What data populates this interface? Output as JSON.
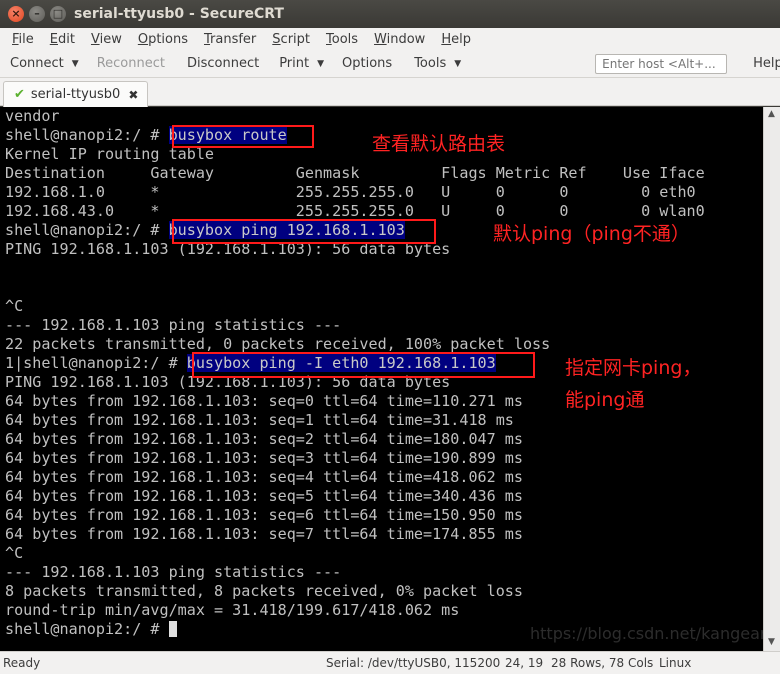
{
  "window": {
    "title": "serial-ttyusb0 - SecureCRT"
  },
  "menu": {
    "items": [
      {
        "mnemonic": "F",
        "rest": "ile"
      },
      {
        "mnemonic": "E",
        "rest": "dit"
      },
      {
        "mnemonic": "V",
        "rest": "iew"
      },
      {
        "mnemonic": "O",
        "rest": "ptions"
      },
      {
        "mnemonic": "T",
        "rest": "ransfer"
      },
      {
        "mnemonic": "S",
        "rest": "cript"
      },
      {
        "mnemonic": "T",
        "rest": "ools"
      },
      {
        "mnemonic": "W",
        "rest": "indow"
      },
      {
        "mnemonic": "H",
        "rest": "elp"
      }
    ]
  },
  "toolbar": {
    "connect": "Connect",
    "reconnect": "Reconnect",
    "disconnect": "Disconnect",
    "print": "Print",
    "options": "Options",
    "tools": "Tools",
    "host_placeholder": "Enter host <Alt+...",
    "help": "Help"
  },
  "tab": {
    "label": "serial-ttyusb0"
  },
  "terminal": {
    "lines": [
      "vendor",
      "shell@nanopi2:/ # busybox route",
      "Kernel IP routing table",
      "Destination     Gateway         Genmask         Flags Metric Ref    Use Iface",
      "192.168.1.0     *               255.255.255.0   U     0      0        0 eth0",
      "192.168.43.0    *               255.255.255.0   U     0      0        0 wlan0",
      "shell@nanopi2:/ # busybox ping 192.168.1.103",
      "PING 192.168.1.103 (192.168.1.103): 56 data bytes",
      "",
      "",
      "^C",
      "--- 192.168.1.103 ping statistics ---",
      "22 packets transmitted, 0 packets received, 100% packet loss",
      "1|shell@nanopi2:/ # busybox ping -I eth0 192.168.1.103",
      "PING 192.168.1.103 (192.168.1.103): 56 data bytes",
      "64 bytes from 192.168.1.103: seq=0 ttl=64 time=110.271 ms",
      "64 bytes from 192.168.1.103: seq=1 ttl=64 time=31.418 ms",
      "64 bytes from 192.168.1.103: seq=2 ttl=64 time=180.047 ms",
      "64 bytes from 192.168.1.103: seq=3 ttl=64 time=190.899 ms",
      "64 bytes from 192.168.1.103: seq=4 ttl=64 time=418.062 ms",
      "64 bytes from 192.168.1.103: seq=5 ttl=64 time=340.436 ms",
      "64 bytes from 192.168.1.103: seq=6 ttl=64 time=150.950 ms",
      "64 bytes from 192.168.1.103: seq=7 ttl=64 time=174.855 ms",
      "^C",
      "--- 192.168.1.103 ping statistics ---",
      "8 packets transmitted, 8 packets received, 0% packet loss",
      "round-trip min/avg/max = 31.418/199.617/418.062 ms",
      "shell@nanopi2:/ # "
    ],
    "highlights": [
      {
        "line": 1,
        "text": "busybox route"
      },
      {
        "line": 6,
        "text": "busybox ping 192.168.1.103"
      },
      {
        "line": 13,
        "text": "busybox ping -I eth0 192.168.1.103"
      }
    ],
    "cursor_line": 27
  },
  "annotations": {
    "route_note": "查看默认路由表",
    "ping_fail_note": "默认ping（ping不通）",
    "ping_iface_note_line1": "指定网卡ping，",
    "ping_iface_note_line2": "能ping通"
  },
  "watermark": "https://blog.csdn.net/kangear",
  "status": {
    "ready": "Ready",
    "serial": "Serial: /dev/ttyUSB0, 115200",
    "position": "24, 19",
    "dims": "28 Rows, 78 Cols",
    "os": "Linux"
  },
  "colors": {
    "highlight_bg": "#000080",
    "annotation_red": "#ff2323",
    "terminal_fg": "#c0c0c0",
    "terminal_bg": "#000000"
  }
}
